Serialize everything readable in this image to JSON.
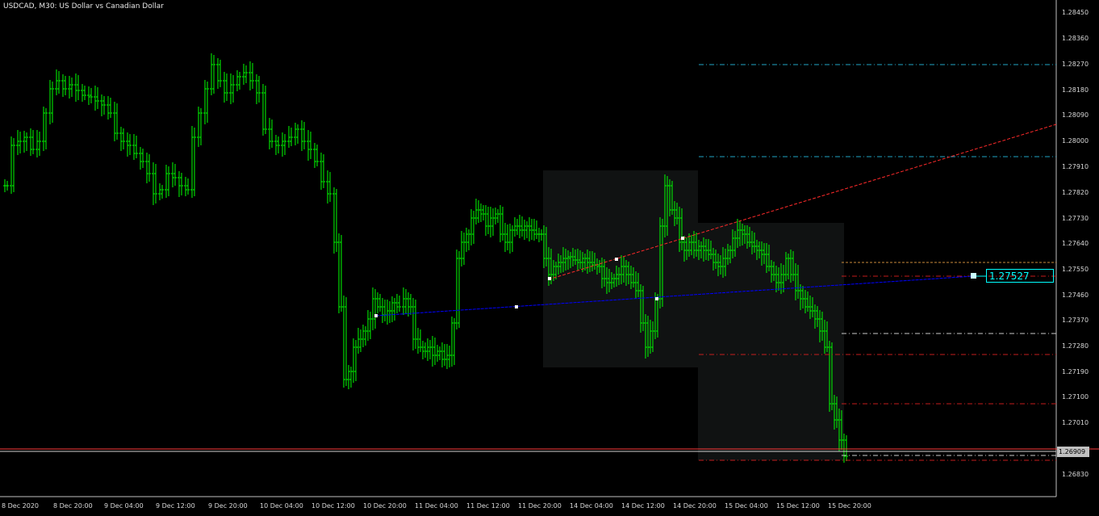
{
  "window": {
    "title": "USDCAD, M30:  US Dollar vs Canadian Dollar"
  },
  "y_axis": {
    "ticks": [
      "1.28450",
      "1.28360",
      "1.28270",
      "1.28180",
      "1.28090",
      "1.28000",
      "1.27910",
      "1.27820",
      "1.27730",
      "1.27640",
      "1.27550",
      "1.27460",
      "1.27370",
      "1.27280",
      "1.27190",
      "1.27100",
      "1.27010",
      "1.26830"
    ]
  },
  "x_axis": {
    "ticks": [
      "8 Dec 2020",
      "8 Dec 20:00",
      "9 Dec 04:00",
      "9 Dec 12:00",
      "9 Dec 20:00",
      "10 Dec 04:00",
      "10 Dec 12:00",
      "10 Dec 20:00",
      "11 Dec 04:00",
      "11 Dec 12:00",
      "11 Dec 20:00",
      "14 Dec 04:00",
      "14 Dec 12:00",
      "14 Dec 20:00",
      "15 Dec 04:00",
      "15 Dec 12:00",
      "15 Dec 20:00"
    ]
  },
  "labels": {
    "line_price": "1.27527",
    "bid_price": "1.26909"
  },
  "colors": {
    "background": "#000000",
    "candle": "#00ff00",
    "trendline_red": "#ff2a2a",
    "trendline_blue": "#0000ff",
    "zone": "#1a1a1a",
    "level_cyan": "#1fa3c4",
    "level_red": "#c41d1d",
    "level_orange": "#c98a3a",
    "level_white": "#c8c8c8",
    "price_label": "#00ffff"
  }
}
